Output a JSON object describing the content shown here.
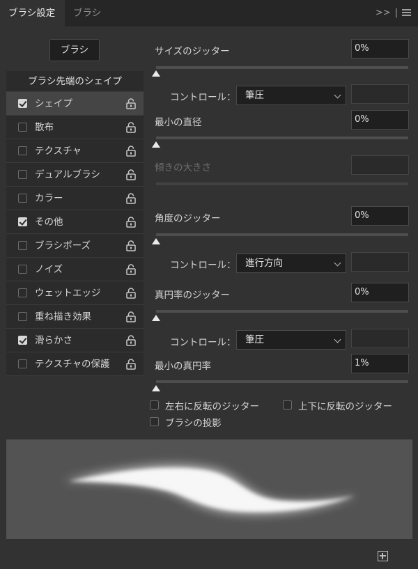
{
  "tabs": [
    {
      "label": "ブラシ設定",
      "active": true
    },
    {
      "label": "ブラシ",
      "active": false
    }
  ],
  "tab_menu": {
    "expand": ">>",
    "separator": "|"
  },
  "brush_button": "ブラシ",
  "list_header": "ブラシ先端のシェイプ",
  "list_items": [
    {
      "label": "シェイプ",
      "checked": true,
      "selected": true
    },
    {
      "label": "散布",
      "checked": false
    },
    {
      "label": "テクスチャ",
      "checked": false
    },
    {
      "label": "デュアルブラシ",
      "checked": false
    },
    {
      "label": "カラー",
      "checked": false
    },
    {
      "label": "その他",
      "checked": true
    },
    {
      "label": "ブラシポーズ",
      "checked": false
    },
    {
      "label": "ノイズ",
      "checked": false
    },
    {
      "label": "ウェットエッジ",
      "checked": false
    },
    {
      "label": "重ね描き効果",
      "checked": false
    },
    {
      "label": "滑らかさ",
      "checked": true
    },
    {
      "label": "テクスチャの保護",
      "checked": false
    }
  ],
  "controls": {
    "size_jitter": {
      "label": "サイズのジッター",
      "value": "0%",
      "slider": 0
    },
    "size_control": {
      "label": "コントロール：",
      "selected": "筆圧"
    },
    "min_diameter": {
      "label": "最小の直径",
      "value": "0%",
      "slider": 0
    },
    "tilt_scale": {
      "label": "傾きの大きさ",
      "value": ""
    },
    "angle_jitter": {
      "label": "角度のジッター",
      "value": "0%",
      "slider": 0
    },
    "angle_control": {
      "label": "コントロール：",
      "selected": "進行方向"
    },
    "roundness_jitter": {
      "label": "真円率のジッター",
      "value": "0%",
      "slider": 0
    },
    "roundness_control": {
      "label": "コントロール：",
      "selected": "筆圧"
    },
    "min_roundness": {
      "label": "最小の真円率",
      "value": "1%",
      "slider": 0
    }
  },
  "options": {
    "flip_x": "左右に反転のジッター",
    "flip_y": "上下に反転のジッター",
    "brush_projection": "ブラシの投影"
  },
  "colors": {
    "panel_bg": "#323232",
    "tabbar_bg": "#262626",
    "field_bg": "#1f1f1f",
    "preview_bg": "#535353"
  }
}
